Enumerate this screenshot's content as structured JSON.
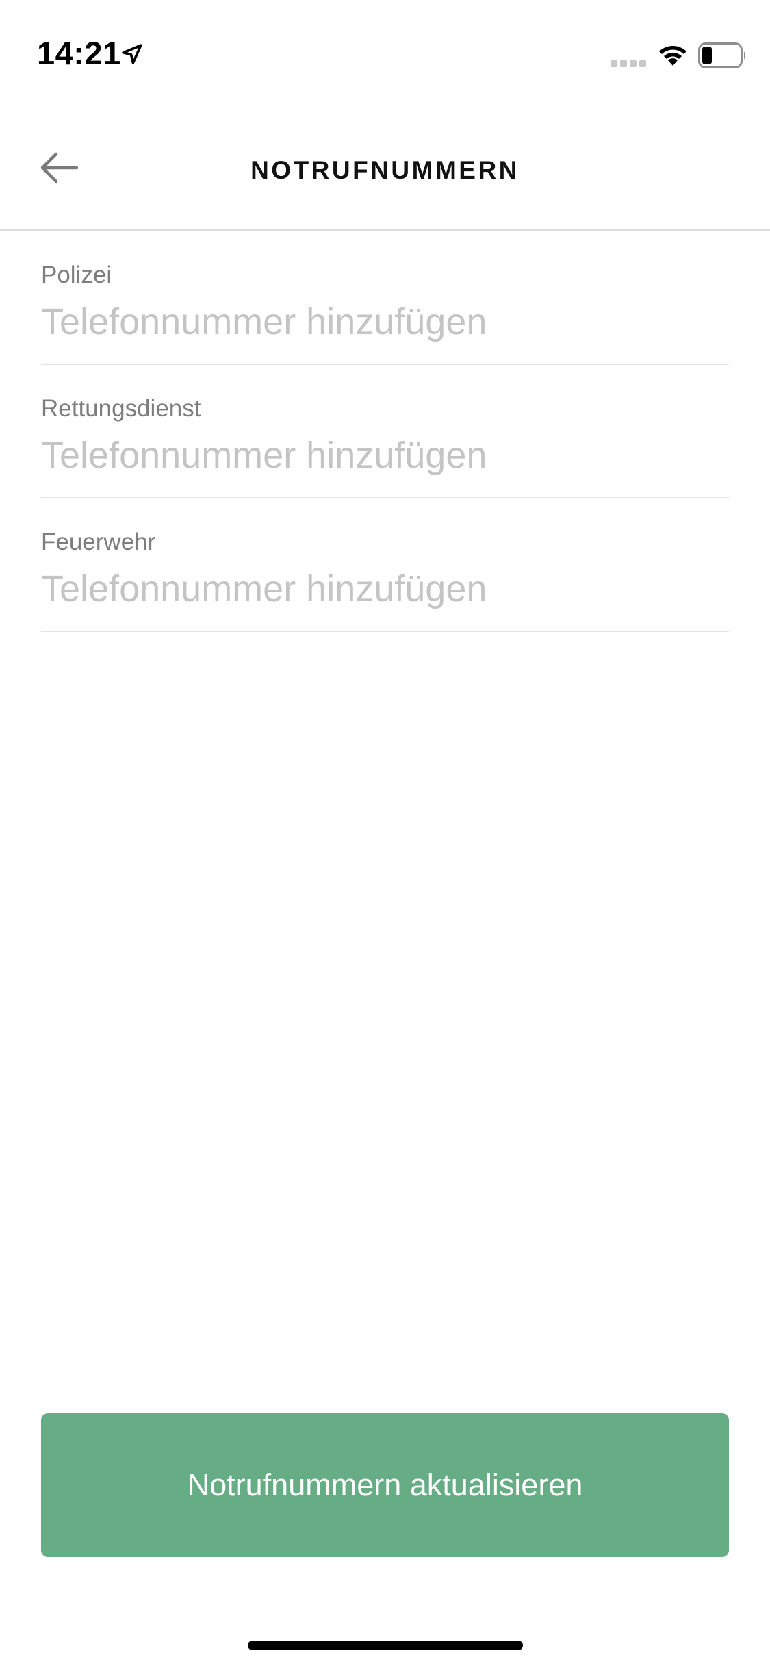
{
  "status_bar": {
    "time": "14:21",
    "icons": [
      "location-arrow-icon",
      "signal-icon",
      "wifi-icon",
      "battery-icon"
    ]
  },
  "nav": {
    "title": "NOTRUFNUMMERN",
    "back_icon": "arrow-left-icon"
  },
  "fields": [
    {
      "label": "Polizei",
      "placeholder": "Telefonnummer hinzufügen",
      "value": ""
    },
    {
      "label": "Rettungsdienst",
      "placeholder": "Telefonnummer hinzufügen",
      "value": ""
    },
    {
      "label": "Feuerwehr",
      "placeholder": "Telefonnummer hinzufügen",
      "value": ""
    }
  ],
  "actions": {
    "update_label": "Notrufnummern aktualisieren"
  },
  "colors": {
    "accent": "#66ad86",
    "label": "#7d7d7d",
    "placeholder": "#c4c4c4",
    "divider": "#e2e2e2"
  }
}
